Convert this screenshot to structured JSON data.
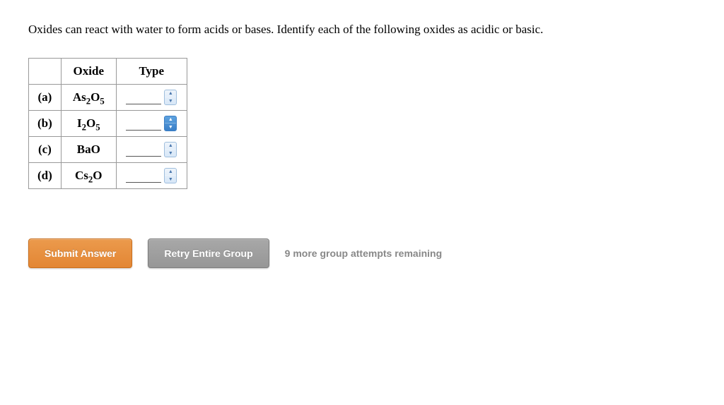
{
  "prompt": "Oxides can react with water to form acids or bases. Identify each of the following oxides as acidic or basic.",
  "table": {
    "headers": {
      "blank": "",
      "oxide": "Oxide",
      "type": "Type"
    },
    "rows": [
      {
        "label": "(a)",
        "formula_html": "As<sub>2</sub>O<sub>5</sub>",
        "value": ""
      },
      {
        "label": "(b)",
        "formula_html": "I<sub>2</sub>O<sub>5</sub>",
        "value": ""
      },
      {
        "label": "(c)",
        "formula_html": "BaO",
        "value": ""
      },
      {
        "label": "(d)",
        "formula_html": "Cs<sub>2</sub>O",
        "value": ""
      }
    ]
  },
  "buttons": {
    "submit": "Submit Answer",
    "retry": "Retry Entire Group"
  },
  "attempts_text": "9 more group attempts remaining"
}
